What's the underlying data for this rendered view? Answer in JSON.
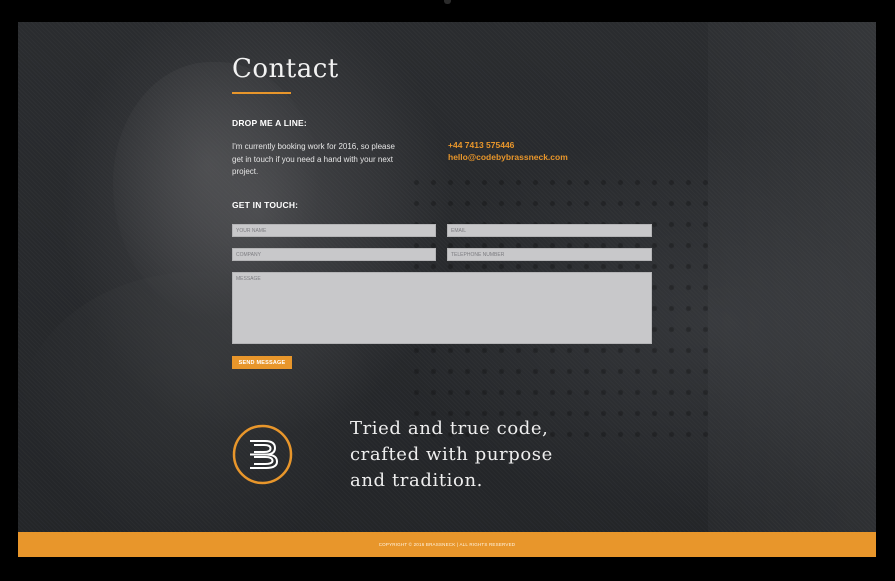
{
  "contact": {
    "heading": "Contact",
    "drop_label": "DROP ME A LINE:",
    "intro": "I'm currently booking work for 2016, so please get in touch if you need a hand with your next project.",
    "phone": "+44 7413 575446",
    "email": "hello@codebybrassneck.com"
  },
  "form": {
    "label": "GET IN TOUCH:",
    "name_placeholder": "YOUR NAME",
    "email_placeholder": "EMAIL",
    "company_placeholder": "COMPANY",
    "phone_placeholder": "TELEPHONE NUMBER",
    "message_placeholder": "MESSAGE",
    "send_label": "SEND MESSAGE"
  },
  "branding": {
    "logo_icon": "brassneck-b-logo-icon",
    "tagline_line1": "Tried and true code,",
    "tagline_line2": "crafted with purpose",
    "tagline_line3": "and tradition."
  },
  "footer": {
    "copyright": "COPYRIGHT © 2016 BRASSNECK | ALL RIGHTS RESERVED"
  },
  "colors": {
    "accent": "#e8962b",
    "background": "#27292c",
    "field": "#c8c8ca",
    "text": "#ffffff"
  }
}
